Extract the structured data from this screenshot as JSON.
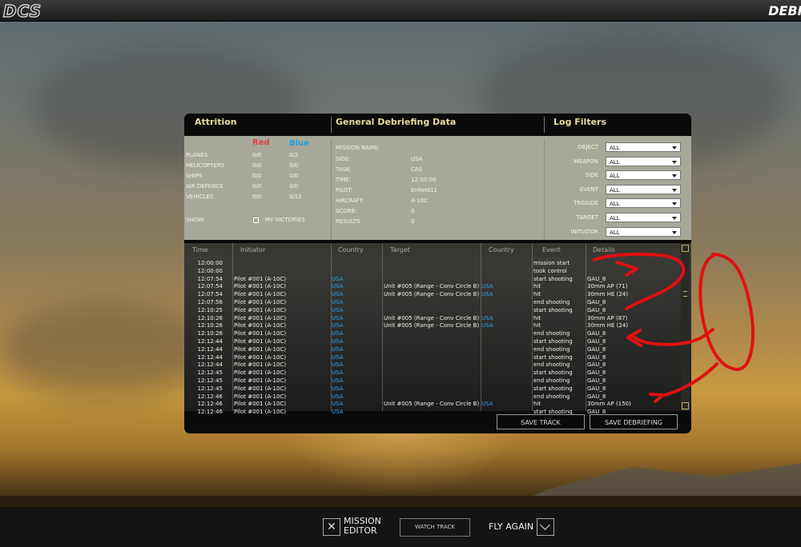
{
  "header": {
    "logo": "DCS",
    "title": "DEBR"
  },
  "attrition": {
    "title": "Attrition",
    "red_label": "Red",
    "blue_label": "Blue",
    "rows": [
      {
        "label": "PLANES",
        "red": "0/0",
        "blue": "0/2"
      },
      {
        "label": "HELICOPTERS",
        "red": "0/0",
        "blue": "0/0"
      },
      {
        "label": "SHIPS",
        "red": "0/0",
        "blue": "0/0"
      },
      {
        "label": "AIR DEFENCE",
        "red": "0/0",
        "blue": "0/0"
      },
      {
        "label": "VEHICLES",
        "red": "0/0",
        "blue": "0/11"
      }
    ],
    "show_label": "SHOW:",
    "my_victories_label": "MY VICTORIES"
  },
  "general": {
    "title": "General Debriefing Data",
    "fields": [
      {
        "label": "MISSION NAME:",
        "value": ""
      },
      {
        "label": "SIDE:",
        "value": "USA"
      },
      {
        "label": "TASK:",
        "value": "CAS"
      },
      {
        "label": "TIME:",
        "value": "12:00:00"
      },
      {
        "label": "PILOT:",
        "value": "Enfield11"
      },
      {
        "label": "AIRCRAFT:",
        "value": "A-10C"
      },
      {
        "label": "SCORE:",
        "value": "0"
      },
      {
        "label": "RESULTS",
        "value": "0"
      }
    ]
  },
  "filters": {
    "title": "Log Filters",
    "items": [
      {
        "label": "OBJECT",
        "value": "ALL"
      },
      {
        "label": "WEAPON",
        "value": "ALL"
      },
      {
        "label": "SIDE",
        "value": "ALL"
      },
      {
        "label": "EVENT",
        "value": "ALL"
      },
      {
        "label": "TRGSIDE",
        "value": "ALL"
      },
      {
        "label": "TARGET",
        "value": "ALL"
      },
      {
        "label": "INITIATOR",
        "value": "ALL"
      }
    ]
  },
  "log": {
    "columns": [
      "Time",
      "Initiator",
      "Country",
      "Target",
      "Country",
      "Event",
      "Details"
    ],
    "rows": [
      {
        "time": "12:00:00",
        "initiator": "",
        "country": "",
        "target": "",
        "tcountry": "",
        "event": "mission start",
        "details": ""
      },
      {
        "time": "12:00:00",
        "initiator": "",
        "country": "",
        "target": "",
        "tcountry": "",
        "event": "took control",
        "details": ""
      },
      {
        "time": "12:07:54",
        "initiator": "Pilot #001 (A-10C)",
        "country": "USA",
        "target": "",
        "tcountry": "",
        "event": "start shooting",
        "details": "GAU_8"
      },
      {
        "time": "12:07:54",
        "initiator": "Pilot #001 (A-10C)",
        "country": "USA",
        "target": "Unit #005 (Range - Conv Circle B)",
        "tcountry": "USA",
        "event": "hit",
        "details": "30mm AP (71)"
      },
      {
        "time": "12:07:54",
        "initiator": "Pilot #001 (A-10C)",
        "country": "USA",
        "target": "Unit #005 (Range - Conv Circle B)",
        "tcountry": "USA",
        "event": "hit",
        "details": "30mm HE (24)"
      },
      {
        "time": "12:07:56",
        "initiator": "Pilot #001 (A-10C)",
        "country": "USA",
        "target": "",
        "tcountry": "",
        "event": "end shooting",
        "details": "GAU_8"
      },
      {
        "time": "12:10:25",
        "initiator": "Pilot #001 (A-10C)",
        "country": "USA",
        "target": "",
        "tcountry": "",
        "event": "start shooting",
        "details": "GAU_8"
      },
      {
        "time": "12:10:26",
        "initiator": "Pilot #001 (A-10C)",
        "country": "USA",
        "target": "Unit #005 (Range - Conv Circle B)",
        "tcountry": "USA",
        "event": "hit",
        "details": "30mm AP (87)"
      },
      {
        "time": "12:10:26",
        "initiator": "Pilot #001 (A-10C)",
        "country": "USA",
        "target": "Unit #005 (Range - Conv Circle B)",
        "tcountry": "USA",
        "event": "hit",
        "details": "30mm HE (24)"
      },
      {
        "time": "12:10:26",
        "initiator": "Pilot #001 (A-10C)",
        "country": "USA",
        "target": "",
        "tcountry": "",
        "event": "end shooting",
        "details": "GAU_8"
      },
      {
        "time": "12:12:44",
        "initiator": "Pilot #001 (A-10C)",
        "country": "USA",
        "target": "",
        "tcountry": "",
        "event": "start shooting",
        "details": "GAU_8"
      },
      {
        "time": "12:12:44",
        "initiator": "Pilot #001 (A-10C)",
        "country": "USA",
        "target": "",
        "tcountry": "",
        "event": "end shooting",
        "details": "GAU_8"
      },
      {
        "time": "12:12:44",
        "initiator": "Pilot #001 (A-10C)",
        "country": "USA",
        "target": "",
        "tcountry": "",
        "event": "start shooting",
        "details": "GAU_8"
      },
      {
        "time": "12:12:44",
        "initiator": "Pilot #001 (A-10C)",
        "country": "USA",
        "target": "",
        "tcountry": "",
        "event": "end shooting",
        "details": "GAU_8"
      },
      {
        "time": "12:12:45",
        "initiator": "Pilot #001 (A-10C)",
        "country": "USA",
        "target": "",
        "tcountry": "",
        "event": "start shooting",
        "details": "GAU_8"
      },
      {
        "time": "12:12:45",
        "initiator": "Pilot #001 (A-10C)",
        "country": "USA",
        "target": "",
        "tcountry": "",
        "event": "end shooting",
        "details": "GAU_8"
      },
      {
        "time": "12:12:45",
        "initiator": "Pilot #001 (A-10C)",
        "country": "USA",
        "target": "",
        "tcountry": "",
        "event": "start shooting",
        "details": "GAU_8"
      },
      {
        "time": "12:12:46",
        "initiator": "Pilot #001 (A-10C)",
        "country": "USA",
        "target": "",
        "tcountry": "",
        "event": "end shooting",
        "details": "GAU_8"
      },
      {
        "time": "12:12:46",
        "initiator": "Pilot #001 (A-10C)",
        "country": "USA",
        "target": "Unit #005 (Range - Conv Circle B)",
        "tcountry": "USA",
        "event": "hit",
        "details": "30mm AP (150)"
      },
      {
        "time": "12:12:46",
        "initiator": "Pilot #001 (A-10C)",
        "country": "USA",
        "target": "",
        "tcountry": "",
        "event": "start shooting",
        "details": "GAU_8"
      }
    ]
  },
  "buttons": {
    "save_track": "SAVE TRACK",
    "save_debriefing": "SAVE DEBRIEFING"
  },
  "footer": {
    "mission_label_line1": "MISSION",
    "mission_label_line2": "EDITOR",
    "watch_track": "WATCH TRACK",
    "fly_again": "FLY AGAIN"
  },
  "colors": {
    "annotation": "#e01010",
    "accent_yellow": "#e7dca0",
    "usa_blue": "#2ea8e8"
  }
}
